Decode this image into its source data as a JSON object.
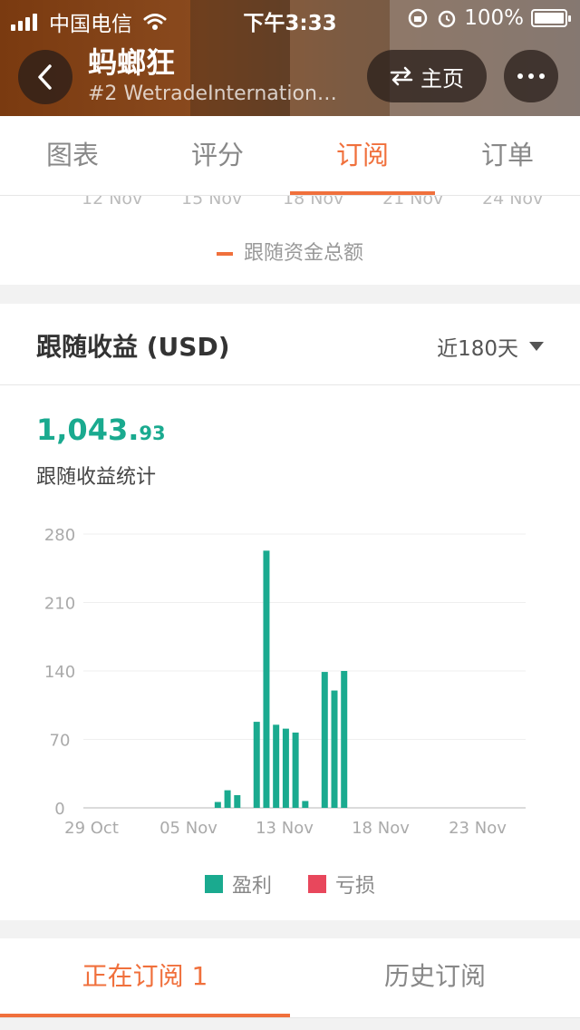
{
  "status_bar": {
    "carrier": "中国电信",
    "time": "下午3:33",
    "battery": "100%"
  },
  "header": {
    "title": "蚂螂狂",
    "subtitle": "#2 WetradeInternation…",
    "home_label": "主页"
  },
  "tabs": [
    {
      "label": "图表"
    },
    {
      "label": "评分"
    },
    {
      "label": "订阅",
      "active": true
    },
    {
      "label": "订单"
    }
  ],
  "prev_chart": {
    "cut_ticks": [
      "12 Nov",
      "15 Nov",
      "18 Nov",
      "21 Nov",
      "24 Nov"
    ],
    "legend": "跟随资金总额"
  },
  "earnings": {
    "title": "跟随收益 (USD)",
    "period": "近180天",
    "total_main": "1,043.",
    "total_decimal": "93",
    "subtitle": "跟随收益统计"
  },
  "chart_data": {
    "type": "bar",
    "x_tick_labels": [
      "29 Oct",
      "05 Nov",
      "13 Nov",
      "18 Nov",
      "23 Nov"
    ],
    "y_ticks": [
      0,
      70,
      140,
      210,
      280
    ],
    "ylim": [
      0,
      280
    ],
    "series": [
      {
        "name": "盈利",
        "color": "#1aaa8f",
        "values": [
          {
            "x": "2019-11-11",
            "y": 6
          },
          {
            "x": "2019-11-12",
            "y": 18
          },
          {
            "x": "2019-11-13",
            "y": 13
          },
          {
            "x": "2019-11-15",
            "y": 88
          },
          {
            "x": "2019-11-16",
            "y": 263
          },
          {
            "x": "2019-11-17",
            "y": 85
          },
          {
            "x": "2019-11-18",
            "y": 81
          },
          {
            "x": "2019-11-19",
            "y": 77
          },
          {
            "x": "2019-11-20",
            "y": 7
          },
          {
            "x": "2019-11-22",
            "y": 139
          },
          {
            "x": "2019-11-23",
            "y": 120
          },
          {
            "x": "2019-11-24",
            "y": 140
          }
        ]
      },
      {
        "name": "亏损",
        "color": "#e8475c",
        "values": []
      }
    ]
  },
  "sub_tabs": [
    {
      "label": "正在订阅 1",
      "active": true
    },
    {
      "label": "历史订阅"
    }
  ]
}
